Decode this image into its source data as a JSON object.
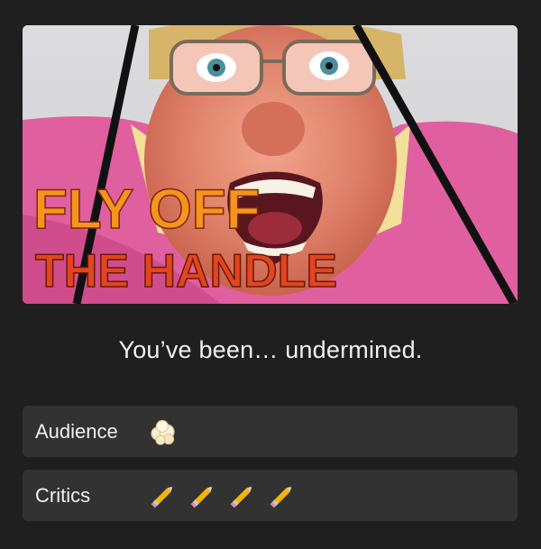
{
  "poster": {
    "title_line1": "FLY OFF",
    "title_line2": "THE HANDLE"
  },
  "tagline": "You’ve been… undermined.",
  "ratings": {
    "audience": {
      "label": "Audience",
      "icon": "popcorn-icon",
      "count": 1
    },
    "critics": {
      "label": "Critics",
      "icon": "pencil-icon",
      "count": 4
    }
  },
  "colors": {
    "background": "#1f1f1f",
    "row": "#323232",
    "title_orange": "#f7941d",
    "title_red": "#e2451f"
  }
}
